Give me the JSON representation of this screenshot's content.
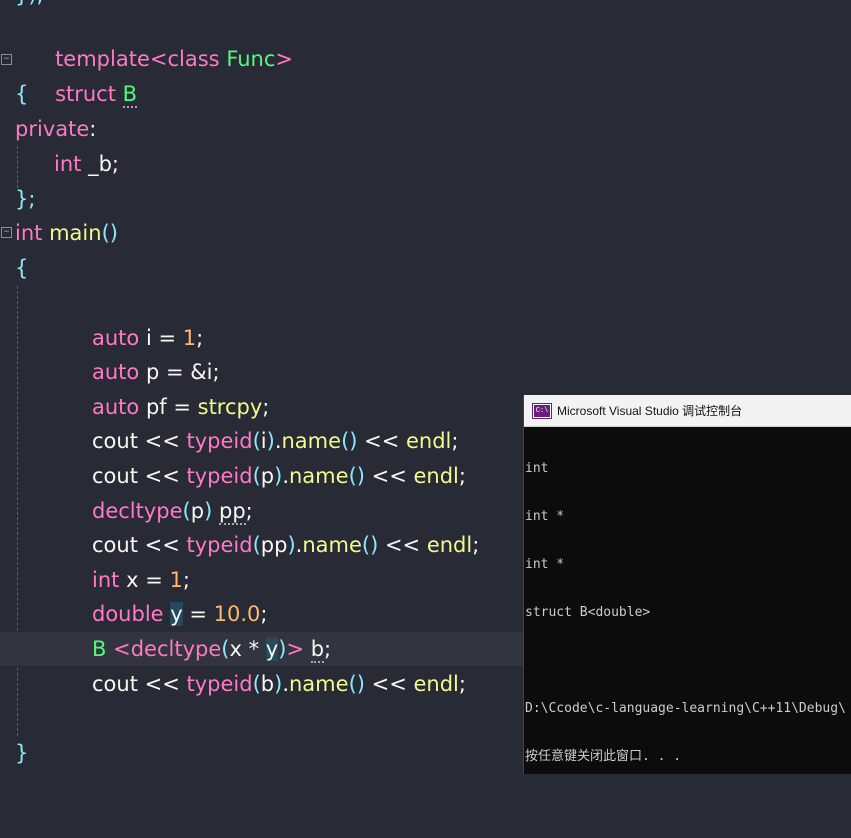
{
  "editor": {
    "lines": {
      "template_kw": "template",
      "template_lt": "<",
      "template_class": "class",
      "template_func": "Func",
      "template_gt": ">",
      "struct_kw": "struct",
      "struct_name": "B",
      "open_brace": "{",
      "private_kw": "private",
      "colon": ":",
      "member_type": "int",
      "member_name": "_b",
      "semicolon": ";",
      "close_brace_semi": "};",
      "main_type": "int",
      "main_name": "main",
      "main_parens": "()",
      "main_open": "{",
      "main_close": "}"
    },
    "body": [
      {
        "kw": "auto",
        "rest": " i = ",
        "num": "1",
        "end": ";"
      },
      {
        "kw": "auto",
        "rest": " p = &i",
        "end": ";"
      },
      {
        "kw": "auto",
        "rest": " pf = ",
        "fn": "strcpy",
        "end": ";"
      }
    ],
    "cout_lines": [
      {
        "cout": "cout",
        "op": " << ",
        "typeid": "typeid",
        "arg": "i",
        "name": "name",
        "endl": "endl"
      },
      {
        "cout": "cout",
        "op": " << ",
        "typeid": "typeid",
        "arg": "p",
        "name": "name",
        "endl": "endl"
      }
    ],
    "decltype_line": {
      "kw": "decltype",
      "arg": "p",
      "var": "pp"
    },
    "cout_pp": {
      "cout": "cout",
      "op": " << ",
      "typeid": "typeid",
      "arg": "pp",
      "name": "name",
      "endl": "endl"
    },
    "int_x": {
      "kw": "int",
      "var": "x",
      "num": "1"
    },
    "double_y": {
      "kw": "double",
      "var": "y",
      "num": "10.0"
    },
    "b_decl": {
      "cls": "B",
      "decltype": "decltype",
      "x": "x",
      "y": "y",
      "var": "b"
    },
    "cout_b": {
      "cout": "cout",
      "op": " << ",
      "typeid": "typeid",
      "arg": "b",
      "name": "name",
      "endl": "endl"
    }
  },
  "console": {
    "title": "Microsoft Visual Studio 调试控制台",
    "icon_label": "C:\\",
    "output": [
      "int",
      "int *",
      "int *",
      "struct B<double>",
      "",
      "D:\\Ccode\\c-language-learning\\C++11\\Debug\\",
      "按任意键关闭此窗口. . ."
    ]
  },
  "colors": {
    "background": "#282a36",
    "keyword": "#ff79c6",
    "type": "#8be9fd",
    "function": "#f1fa8c",
    "number": "#ffb86c",
    "class": "#50fa7b"
  }
}
